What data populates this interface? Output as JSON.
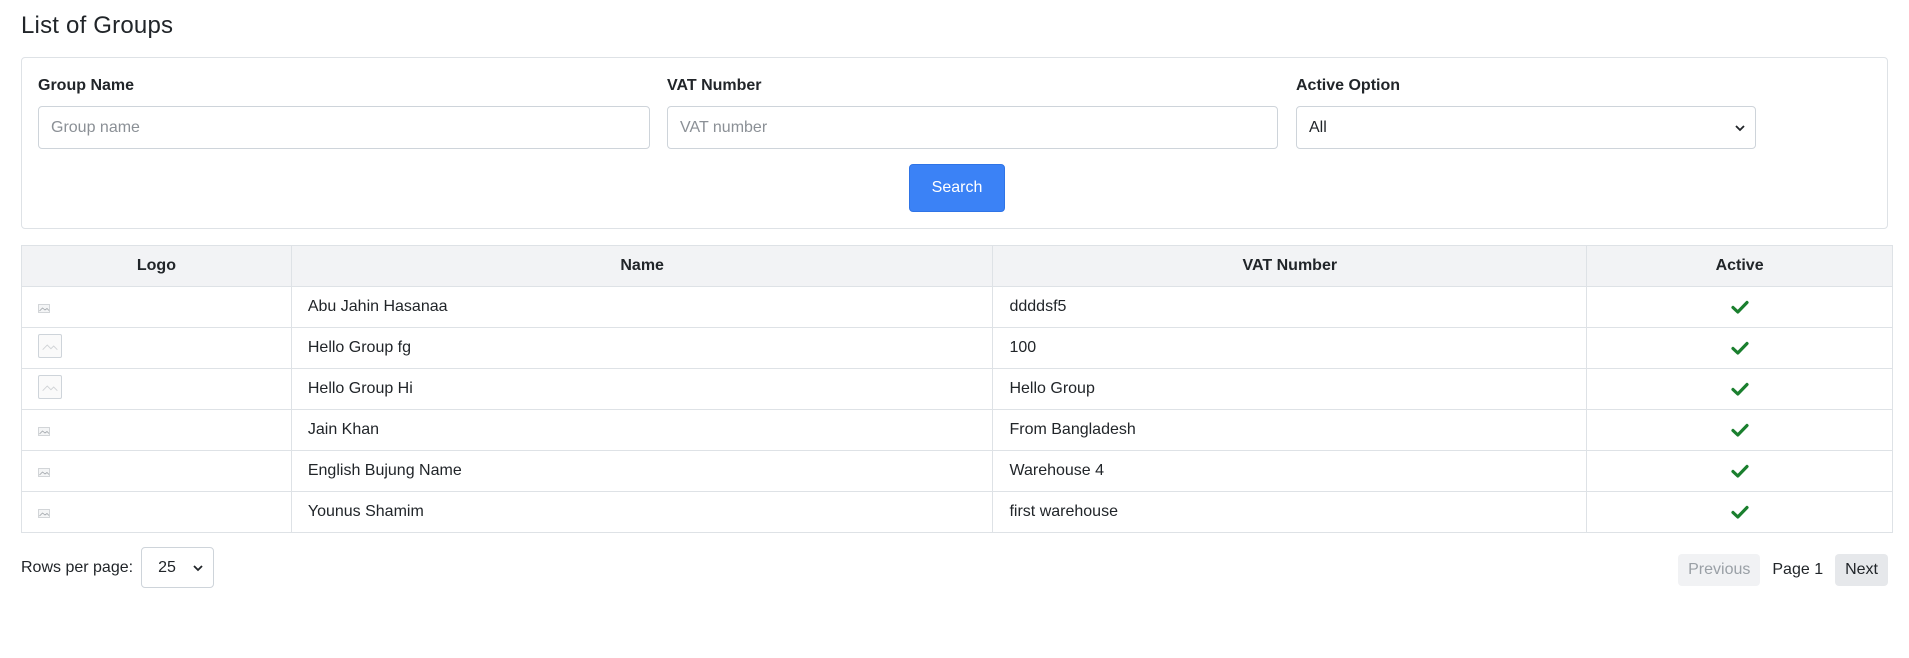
{
  "page": {
    "title": "List of Groups"
  },
  "filters": {
    "group_name": {
      "label": "Group Name",
      "placeholder": "Group name"
    },
    "vat_number": {
      "label": "VAT Number",
      "placeholder": "VAT number"
    },
    "active_option": {
      "label": "Active Option",
      "value": "All"
    },
    "search_label": "Search"
  },
  "table": {
    "columns": [
      "Logo",
      "Name",
      "VAT Number",
      "Active"
    ],
    "rows": [
      {
        "logo": "broken-image-icon",
        "name": "Abu Jahin Hasanaa",
        "vat": "ddddsf5",
        "active": true
      },
      {
        "logo": "image-thumbnail",
        "name": "Hello Group fg",
        "vat": "100",
        "active": true
      },
      {
        "logo": "image-thumbnail",
        "name": "Hello Group Hi",
        "vat": "Hello Group",
        "active": true
      },
      {
        "logo": "broken-image-icon",
        "name": "Jain Khan",
        "vat": "From Bangladesh",
        "active": true
      },
      {
        "logo": "broken-image-icon",
        "name": "English Bujung Name",
        "vat": "Warehouse 4",
        "active": true
      },
      {
        "logo": "broken-image-icon",
        "name": "Younus Shamim",
        "vat": "first warehouse",
        "active": true
      }
    ]
  },
  "pagination": {
    "rows_per_page_label": "Rows per page:",
    "rows_per_page_value": "25",
    "previous_label": "Previous",
    "page_label": "Page 1",
    "next_label": "Next"
  },
  "colors": {
    "accent": "#3b82f6",
    "check": "#1a7f2e"
  }
}
